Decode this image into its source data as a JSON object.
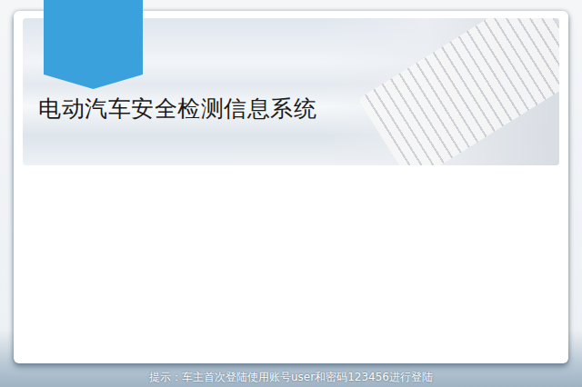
{
  "title": "电动汽车安全检测信息系统",
  "tip": "提示：车主首次登陆使用账号user和密码123456进行登陆"
}
